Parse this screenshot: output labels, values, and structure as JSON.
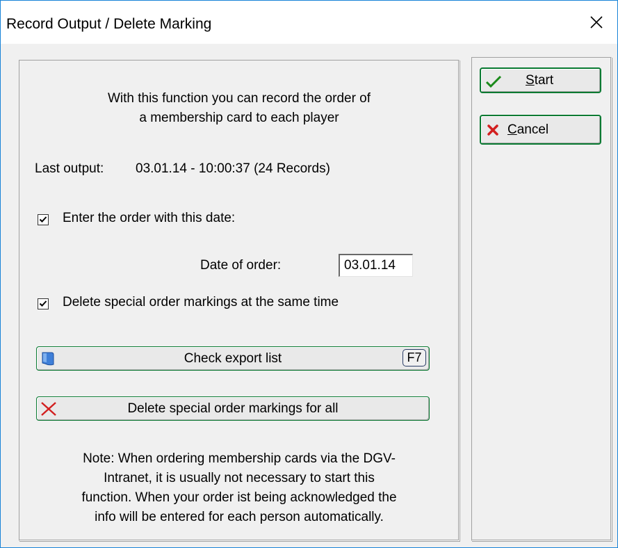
{
  "window": {
    "title": "Record Output / Delete Marking"
  },
  "main": {
    "intro_line1": "With this function you can record the order of",
    "intro_line2": "a membership card to each player",
    "last_output_label": "Last output:",
    "last_output_value": "03.01.14 - 10:00:37 (24 Records)",
    "enter_order_checkbox": {
      "label": "Enter the order with this date:",
      "checked": true
    },
    "date_of_order_label": "Date of order:",
    "date_of_order_value": "03.01.14",
    "delete_markings_checkbox": {
      "label": "Delete special order markings at the same time",
      "checked": true
    },
    "check_export_button": {
      "label": "Check export list",
      "shortcut": "F7",
      "icon": "document-icon"
    },
    "delete_all_button": {
      "label": "Delete special order markings for all",
      "icon": "red-x-icon"
    },
    "note_line1": "Note: When ordering membership cards via the DGV-",
    "note_line2": "Intranet, it is usually not necessary to start this",
    "note_line3": "function. When your order ist being acknowledged the",
    "note_line4": "info will be entered for each person automatically."
  },
  "side": {
    "start_button": {
      "mnemonic": "S",
      "rest": "tart",
      "icon": "green-check-icon"
    },
    "cancel_button": {
      "mnemonic": "C",
      "rest": "ancel",
      "icon": "red-x-icon"
    }
  },
  "colors": {
    "window_border": "#1883d7",
    "button_border": "#0a7a32",
    "check_green": "#1a8a1a",
    "cancel_red": "#d21f1f"
  }
}
